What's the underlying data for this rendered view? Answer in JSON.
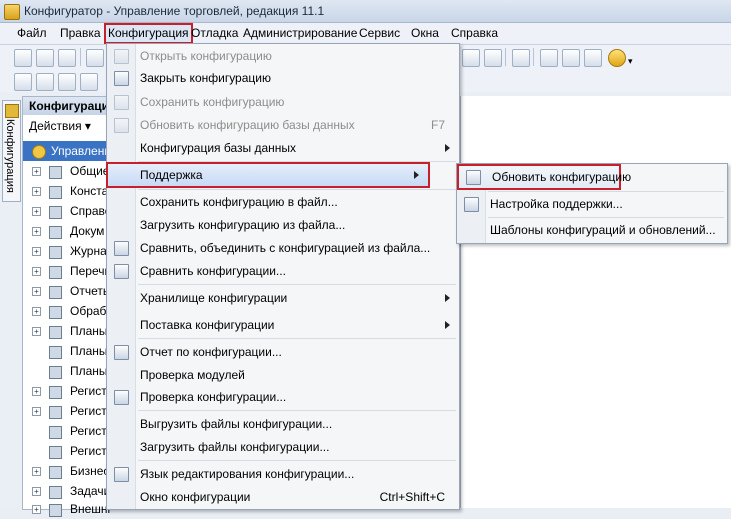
{
  "window": {
    "title": "Конфигуратор - Управление торговлей, редакция 11.1"
  },
  "menubar": {
    "items": [
      "Файл",
      "Правка",
      "Конфигурация",
      "Отладка",
      "Администрирование",
      "Сервис",
      "Окна",
      "Справка"
    ],
    "active": "Конфигурация"
  },
  "side_tab": {
    "label": "Конфигурация"
  },
  "tree": {
    "header": "Конфигурация",
    "actions": "Действия ▾",
    "root": "Управление",
    "items": [
      "Общие",
      "Конста",
      "Справо",
      "Докум",
      "Журна",
      "Перечи",
      "Отчеты",
      "Обрабо",
      "Планы",
      "Планы",
      "Планы",
      "Регист",
      "Регист",
      "Регист",
      "Регист",
      "Бизнес",
      "Задачи",
      "Внешні"
    ]
  },
  "menu": {
    "items": [
      {
        "label": "Открыть конфигурацию",
        "disabled": true,
        "icon": "open-config-icon"
      },
      {
        "label": "Закрыть конфигурацию",
        "disabled": false,
        "icon": "close-config-icon"
      },
      {
        "label": "Сохранить конфигурацию",
        "disabled": true,
        "icon": "save-config-icon"
      },
      {
        "label": "Обновить конфигурацию базы данных",
        "disabled": true,
        "shortcut": "F7",
        "icon": "update-db-icon"
      },
      {
        "label": "Конфигурация базы данных",
        "disabled": false,
        "submenu": true
      },
      {
        "label": "Поддержка",
        "disabled": false,
        "submenu": true,
        "highlighted": true
      },
      {
        "label": "Сохранить конфигурацию в файл...",
        "disabled": false
      },
      {
        "label": "Загрузить конфигурацию из файла...",
        "disabled": false
      },
      {
        "label": "Сравнить, объединить с конфигурацией из файла...",
        "disabled": false,
        "icon": "compare-merge-icon"
      },
      {
        "label": "Сравнить конфигурации...",
        "disabled": false,
        "icon": "compare-icon"
      },
      {
        "label": "Хранилище конфигурации",
        "disabled": false,
        "submenu": true
      },
      {
        "label": "Поставка конфигурации",
        "disabled": false,
        "submenu": true
      },
      {
        "label": "Отчет по конфигурации...",
        "disabled": false,
        "icon": "report-icon"
      },
      {
        "label": "Проверка модулей",
        "disabled": false
      },
      {
        "label": "Проверка конфигурации...",
        "disabled": false,
        "icon": "check-config-icon"
      },
      {
        "label": "Выгрузить файлы конфигурации...",
        "disabled": false
      },
      {
        "label": "Загрузить файлы конфигурации...",
        "disabled": false
      },
      {
        "label": "Язык редактирования конфигурации...",
        "disabled": false,
        "icon": "language-icon"
      },
      {
        "label": "Окно конфигурации",
        "disabled": false,
        "shortcut": "Ctrl+Shift+C"
      }
    ]
  },
  "submenu": {
    "items": [
      {
        "label": "Обновить конфигурацию",
        "highlighted": true,
        "icon": "update-config-icon"
      },
      {
        "label": "Настройка поддержки...",
        "icon": "support-settings-icon"
      },
      {
        "label": "Шаблоны конфигураций и обновлений..."
      }
    ]
  }
}
